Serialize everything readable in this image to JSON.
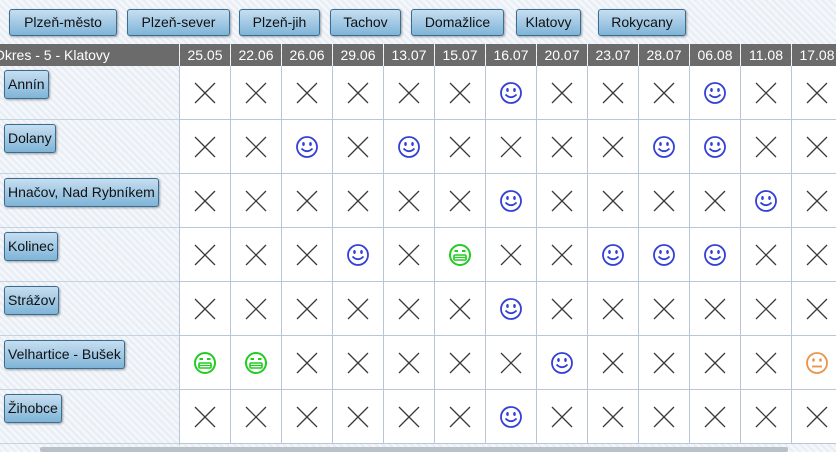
{
  "tabs": [
    "Plzeň-město",
    "Plzeň-sever",
    "Plzeň-jih",
    "Tachov",
    "Domažlice",
    "Klatovy",
    "Rokycany"
  ],
  "table": {
    "header_first": "Okres - 5 - Klatovy",
    "dates": [
      "25.05",
      "22.06",
      "26.06",
      "29.06",
      "13.07",
      "15.07",
      "16.07",
      "20.07",
      "23.07",
      "28.07",
      "06.08",
      "11.08",
      "17.08"
    ],
    "rows": [
      {
        "label": "Annín",
        "cells": [
          "x",
          "x",
          "x",
          "x",
          "x",
          "x",
          "smile-blue",
          "x",
          "x",
          "x",
          "smile-blue",
          "x",
          "x"
        ]
      },
      {
        "label": "Dolany",
        "cells": [
          "x",
          "x",
          "smile-blue",
          "x",
          "smile-blue",
          "x",
          "x",
          "x",
          "x",
          "smile-blue",
          "smile-blue",
          "x",
          "x"
        ]
      },
      {
        "label": "Hnačov, Nad Rybníkem",
        "cells": [
          "x",
          "x",
          "x",
          "x",
          "x",
          "x",
          "smile-blue",
          "x",
          "x",
          "x",
          "x",
          "smile-blue",
          "x"
        ]
      },
      {
        "label": "Kolinec",
        "cells": [
          "x",
          "x",
          "x",
          "smile-blue",
          "x",
          "grin-green",
          "x",
          "x",
          "smile-blue",
          "smile-blue",
          "smile-blue",
          "x",
          "x"
        ]
      },
      {
        "label": "Strážov",
        "cells": [
          "x",
          "x",
          "x",
          "x",
          "x",
          "x",
          "smile-blue",
          "x",
          "x",
          "x",
          "x",
          "x",
          "x"
        ]
      },
      {
        "label": "Velhartice - Bušek",
        "cells": [
          "grin-green",
          "grin-green",
          "x",
          "x",
          "x",
          "x",
          "x",
          "smile-blue",
          "x",
          "x",
          "x",
          "x",
          "neutral-orange"
        ]
      },
      {
        "label": "Žihobce",
        "cells": [
          "x",
          "x",
          "x",
          "x",
          "x",
          "x",
          "smile-blue",
          "x",
          "x",
          "x",
          "x",
          "x",
          "x"
        ]
      }
    ]
  },
  "colors": {
    "blue": "#3340d8",
    "green": "#22cc22",
    "orange": "#e8944a",
    "x": "#3a3a3a"
  }
}
